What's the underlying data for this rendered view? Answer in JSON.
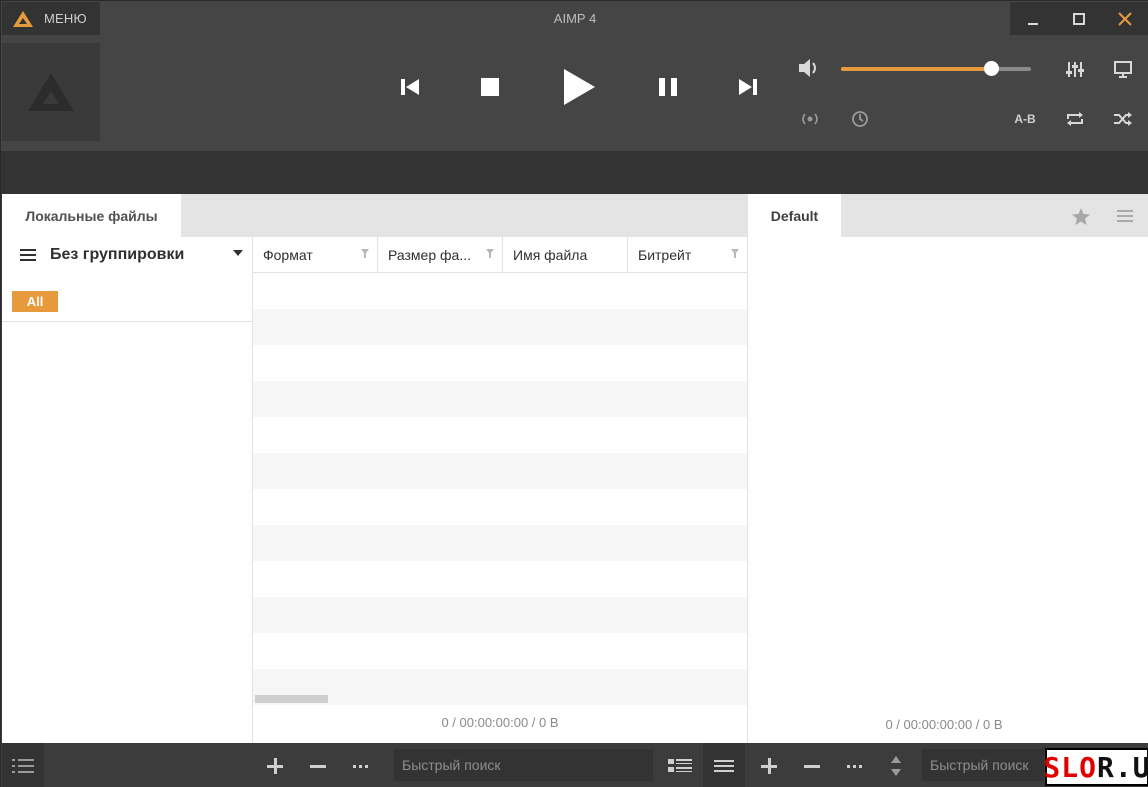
{
  "window": {
    "title": "AIMP 4",
    "menu_label": "МЕНЮ"
  },
  "player": {
    "volume_level": 0.79,
    "ab_label": "A-B",
    "accent_color": "#e79a3b"
  },
  "left_panel": {
    "tab_label": "Локальные файлы",
    "grouping_label": "Без группировки",
    "all_badge": "All",
    "columns": [
      "Формат",
      "Размер фа...",
      "Имя файла",
      "Битрейт"
    ],
    "status": "0 / 00:00:00:00 / 0 B"
  },
  "right_panel": {
    "tab_label": "Default",
    "status": "0 / 00:00:00:00 / 0 B"
  },
  "bottom": {
    "search_placeholder_left": "Быстрый поиск",
    "search_placeholder_right": "Быстрый поиск"
  },
  "watermark": {
    "part1": "SLO",
    "part2": "R.U"
  }
}
